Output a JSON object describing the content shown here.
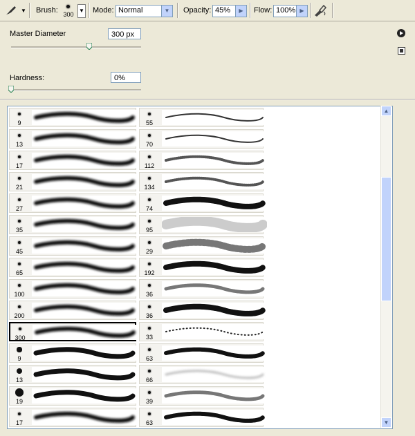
{
  "toolbar": {
    "tool_icon": "brush-tool-icon",
    "brush_label": "Brush:",
    "brush_size": "300",
    "mode_label": "Mode:",
    "mode_value": "Normal",
    "opacity_label": "Opacity:",
    "opacity_value": "45%",
    "flow_label": "Flow:",
    "flow_value": "100%",
    "airbrush_icon": "airbrush-icon"
  },
  "options": {
    "master_label": "Master Diameter",
    "master_value": "300 px",
    "master_fraction": 0.6,
    "hardness_label": "Hardness:",
    "hardness_value": "0%",
    "hardness_fraction": 0.0
  },
  "brushes_left": [
    {
      "size": "9",
      "kind": "soft"
    },
    {
      "size": "13",
      "kind": "soft"
    },
    {
      "size": "17",
      "kind": "soft"
    },
    {
      "size": "21",
      "kind": "soft"
    },
    {
      "size": "27",
      "kind": "soft"
    },
    {
      "size": "35",
      "kind": "soft"
    },
    {
      "size": "45",
      "kind": "soft"
    },
    {
      "size": "65",
      "kind": "soft"
    },
    {
      "size": "100",
      "kind": "soft"
    },
    {
      "size": "200",
      "kind": "soft"
    },
    {
      "size": "300",
      "kind": "soft",
      "selected": true
    },
    {
      "size": "9",
      "kind": "hard"
    },
    {
      "size": "13",
      "kind": "hard"
    },
    {
      "size": "19",
      "kind": "hard"
    },
    {
      "size": "17",
      "kind": "soft"
    }
  ],
  "brushes_right": [
    {
      "size": "55",
      "kind": "thin"
    },
    {
      "size": "70",
      "kind": "thin"
    },
    {
      "size": "112",
      "kind": "grass"
    },
    {
      "size": "134",
      "kind": "grass"
    },
    {
      "size": "74",
      "kind": "leaf"
    },
    {
      "size": "95",
      "kind": "spot"
    },
    {
      "size": "29",
      "kind": "star"
    },
    {
      "size": "192",
      "kind": "rough"
    },
    {
      "size": "36",
      "kind": "speckle"
    },
    {
      "size": "36",
      "kind": "rough"
    },
    {
      "size": "33",
      "kind": "dots"
    },
    {
      "size": "63",
      "kind": "hardrough"
    },
    {
      "size": "66",
      "kind": "faint"
    },
    {
      "size": "39",
      "kind": "speckle"
    },
    {
      "size": "63",
      "kind": "hardrough"
    }
  ]
}
